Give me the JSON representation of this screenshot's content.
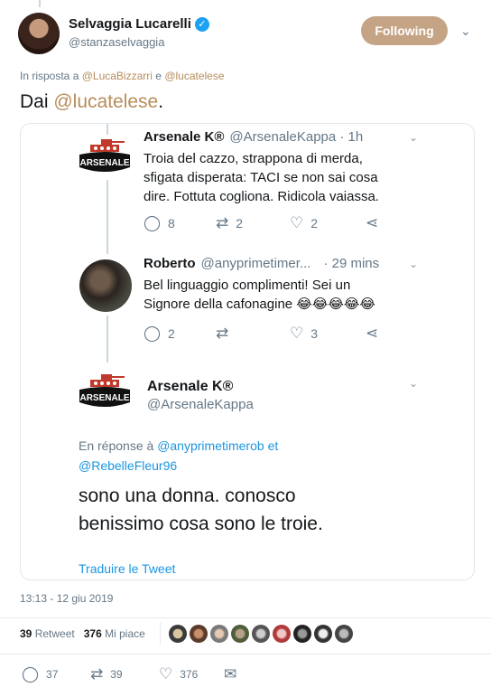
{
  "author": {
    "display_name": "Selvaggia Lucarelli",
    "handle": "@stanzaselvaggia",
    "verified_icon": "verified-badge-icon",
    "follow_label": "Following"
  },
  "reply_to": {
    "prefix": "In risposta a",
    "user1": "@LucaBizzarri",
    "conj": "e",
    "user2": "@lucatelese"
  },
  "tweet": {
    "text_prefix": "Dai ",
    "mention": "@lucatelese",
    "text_suffix": "."
  },
  "quoted_thread": {
    "tweet1": {
      "name": "Arsenale K®",
      "meta": "@ArsenaleKappa · 1h",
      "lines": [
        "Troia del cazzo, strappona di merda,",
        "sfigata disperata: TACI se non sai cosa",
        "dire. Fottuta cogliona. Ridicola vaiassa."
      ],
      "replies": "8",
      "retweets": "2",
      "likes": "2"
    },
    "tweet2": {
      "name": "Roberto",
      "meta_handle": "@anyprimetimer...",
      "meta_time": "· 29 mins",
      "line1": "Bel linguaggio complimenti!  Sei un",
      "line2": "Signore della cafonagine 😂😂😂😂😂",
      "replies": "2",
      "retweets": "",
      "likes": "3"
    },
    "tweet3": {
      "name": "Arsenale K®",
      "handle": "@ArsenaleKappa",
      "en_reponse_prefix": "En réponse à",
      "en_reponse_user1": "@anyprimetimerob",
      "en_reponse_conj": "et",
      "en_reponse_user2": "@RebelleFleur96",
      "line1": "sono una donna. conosco",
      "line2": "benissimo cosa sono le troie.",
      "translate": "Traduire le Tweet"
    }
  },
  "timestamp": "13:13 - 12 giu 2019",
  "stats": {
    "retweets_count": "39",
    "retweets_label": "Retweet",
    "likes_count": "376",
    "likes_label": "Mi piace"
  },
  "actions": {
    "replies": "37",
    "retweets": "39",
    "likes": "376"
  },
  "colors": {
    "accent": "#b88c5a",
    "follow_bg": "#c4a484",
    "link_blue": "#1b95e0",
    "verified": "#1da1f2"
  }
}
